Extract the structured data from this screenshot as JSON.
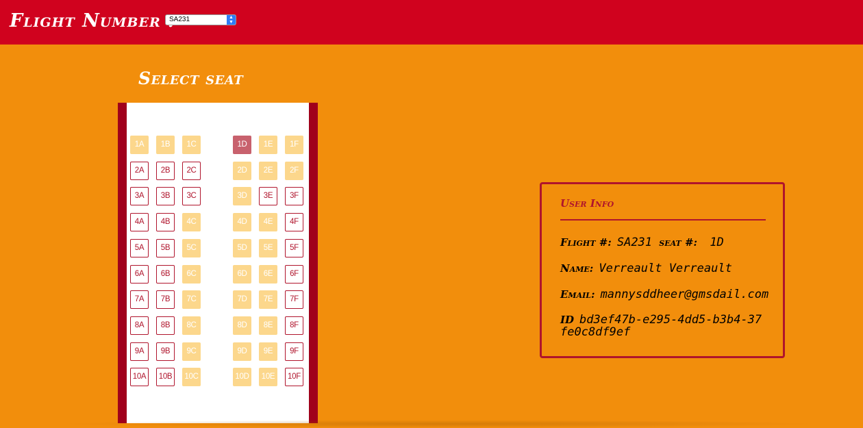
{
  "header": {
    "title": "Flight Number :",
    "flight_select_value": "SA231",
    "select_arrow": "⌃⌄"
  },
  "seat_map": {
    "title": "Select seat",
    "rows": [
      {
        "seats": [
          {
            "label": "1A",
            "status": "taken"
          },
          {
            "label": "1B",
            "status": "taken"
          },
          {
            "label": "1C",
            "status": "taken"
          },
          {
            "label": "1D",
            "status": "selected"
          },
          {
            "label": "1E",
            "status": "taken"
          },
          {
            "label": "1F",
            "status": "taken"
          }
        ]
      },
      {
        "seats": [
          {
            "label": "2A",
            "status": "available"
          },
          {
            "label": "2B",
            "status": "available"
          },
          {
            "label": "2C",
            "status": "available"
          },
          {
            "label": "2D",
            "status": "taken"
          },
          {
            "label": "2E",
            "status": "taken"
          },
          {
            "label": "2F",
            "status": "taken"
          }
        ]
      },
      {
        "seats": [
          {
            "label": "3A",
            "status": "available"
          },
          {
            "label": "3B",
            "status": "available"
          },
          {
            "label": "3C",
            "status": "available"
          },
          {
            "label": "3D",
            "status": "taken"
          },
          {
            "label": "3E",
            "status": "available"
          },
          {
            "label": "3F",
            "status": "available"
          }
        ]
      },
      {
        "seats": [
          {
            "label": "4A",
            "status": "available"
          },
          {
            "label": "4B",
            "status": "available"
          },
          {
            "label": "4C",
            "status": "taken"
          },
          {
            "label": "4D",
            "status": "taken"
          },
          {
            "label": "4E",
            "status": "taken"
          },
          {
            "label": "4F",
            "status": "available"
          }
        ]
      },
      {
        "seats": [
          {
            "label": "5A",
            "status": "available"
          },
          {
            "label": "5B",
            "status": "available"
          },
          {
            "label": "5C",
            "status": "taken"
          },
          {
            "label": "5D",
            "status": "taken"
          },
          {
            "label": "5E",
            "status": "taken"
          },
          {
            "label": "5F",
            "status": "available"
          }
        ]
      },
      {
        "seats": [
          {
            "label": "6A",
            "status": "available"
          },
          {
            "label": "6B",
            "status": "available"
          },
          {
            "label": "6C",
            "status": "taken"
          },
          {
            "label": "6D",
            "status": "taken"
          },
          {
            "label": "6E",
            "status": "taken"
          },
          {
            "label": "6F",
            "status": "available"
          }
        ]
      },
      {
        "seats": [
          {
            "label": "7A",
            "status": "available"
          },
          {
            "label": "7B",
            "status": "available"
          },
          {
            "label": "7C",
            "status": "taken"
          },
          {
            "label": "7D",
            "status": "taken"
          },
          {
            "label": "7E",
            "status": "taken"
          },
          {
            "label": "7F",
            "status": "available"
          }
        ]
      },
      {
        "seats": [
          {
            "label": "8A",
            "status": "available"
          },
          {
            "label": "8B",
            "status": "available"
          },
          {
            "label": "8C",
            "status": "taken"
          },
          {
            "label": "8D",
            "status": "taken"
          },
          {
            "label": "8E",
            "status": "taken"
          },
          {
            "label": "8F",
            "status": "available"
          }
        ]
      },
      {
        "seats": [
          {
            "label": "9A",
            "status": "available"
          },
          {
            "label": "9B",
            "status": "available"
          },
          {
            "label": "9C",
            "status": "taken"
          },
          {
            "label": "9D",
            "status": "taken"
          },
          {
            "label": "9E",
            "status": "taken"
          },
          {
            "label": "9F",
            "status": "available"
          }
        ]
      },
      {
        "seats": [
          {
            "label": "10A",
            "status": "available"
          },
          {
            "label": "10B",
            "status": "available"
          },
          {
            "label": "10C",
            "status": "taken"
          },
          {
            "label": "10D",
            "status": "taken"
          },
          {
            "label": "10E",
            "status": "taken"
          },
          {
            "label": "10F",
            "status": "available"
          }
        ]
      }
    ]
  },
  "user_info": {
    "title": "User Info",
    "flight_label": "Flight #:",
    "flight_value": "SA231",
    "seat_label": "seat #:",
    "seat_value": "1D",
    "name_label": "Name:",
    "name_value": "Verreault Verreault",
    "email_label": "Email:",
    "email_value": "mannysddheer@gmsdail.com",
    "id_label": "ID",
    "id_value": "bd3ef47b-e295-4dd5-b3b4-37fe0c8df9ef"
  },
  "colors": {
    "background": "#f28e0c",
    "header": "#d0021e",
    "accent": "#b0142c",
    "seat_taken": "#fcd78c",
    "seat_selected": "#c8616d"
  }
}
